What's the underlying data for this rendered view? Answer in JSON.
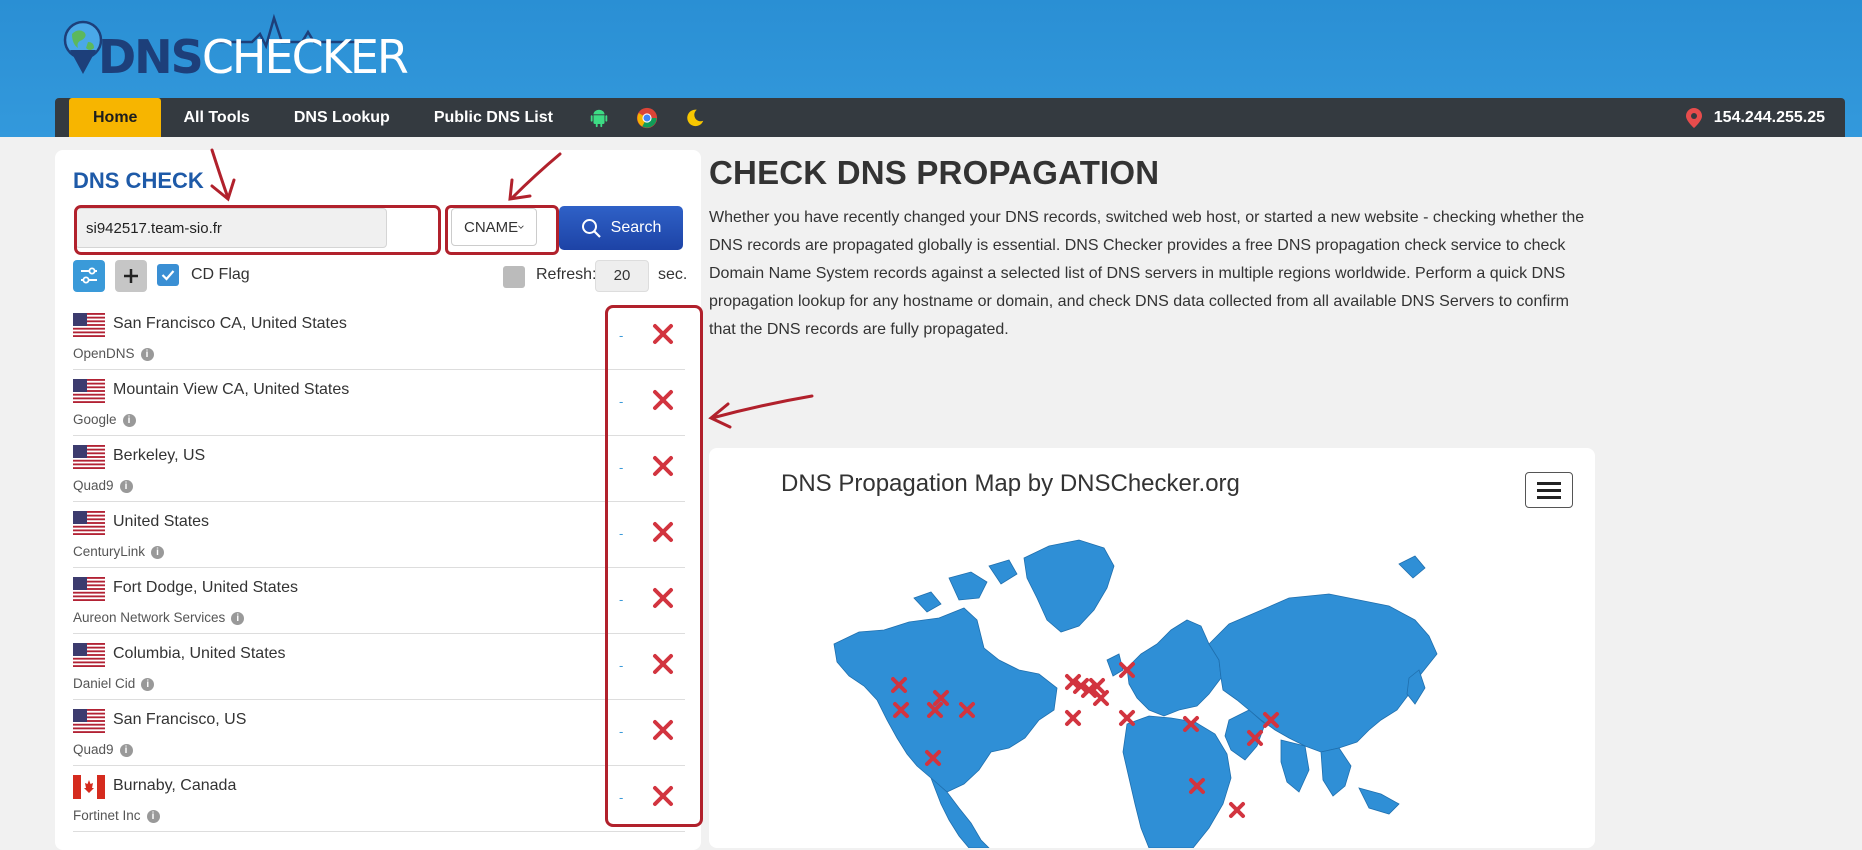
{
  "header": {
    "logo_dns": "DNS",
    "logo_checker": "CHECKER"
  },
  "nav": {
    "items": [
      "Home",
      "All Tools",
      "DNS Lookup",
      "Public DNS List"
    ],
    "icons": [
      "android-icon",
      "chrome-icon",
      "moon-icon"
    ],
    "ip": "154.244.255.25"
  },
  "dns_check": {
    "title": "DNS CHECK",
    "domain_value": "si942517.team-sio.fr",
    "record_type": "CNAME",
    "search_label": "Search",
    "cd_flag_label": "CD Flag",
    "refresh_label": "Refresh:",
    "refresh_value": "20",
    "refresh_unit": "sec."
  },
  "servers": [
    {
      "location": "San Francisco CA, United States",
      "provider": "OpenDNS",
      "flag": "us",
      "result": "-"
    },
    {
      "location": "Mountain View CA, United States",
      "provider": "Google",
      "flag": "us",
      "result": "-"
    },
    {
      "location": "Berkeley, US",
      "provider": "Quad9",
      "flag": "us",
      "result": "-"
    },
    {
      "location": "United States",
      "provider": "CenturyLink",
      "flag": "us",
      "result": "-"
    },
    {
      "location": "Fort Dodge, United States",
      "provider": "Aureon Network Services",
      "flag": "us",
      "result": "-"
    },
    {
      "location": "Columbia, United States",
      "provider": "Daniel Cid",
      "flag": "us",
      "result": "-"
    },
    {
      "location": "San Francisco, US",
      "provider": "Quad9",
      "flag": "us",
      "result": "-"
    },
    {
      "location": "Burnaby, Canada",
      "provider": "Fortinet Inc",
      "flag": "ca",
      "result": "-"
    }
  ],
  "content": {
    "title": "CHECK DNS PROPAGATION",
    "description": "Whether you have recently changed your DNS records, switched web host, or started a new website - checking whether the DNS records are propagated globally is essential. DNS Checker provides a free DNS propagation check service to check Domain Name System records against a selected list of DNS servers in multiple regions worldwide. Perform a quick DNS propagation lookup for any hostname or domain, and check DNS data collected from all available DNS Servers to confirm that the DNS records are fully propagated."
  },
  "map": {
    "title": "DNS Propagation Map by DNSChecker.org"
  },
  "colors": {
    "header_blue": "#3399dc",
    "nav_dark": "#343a40",
    "accent_yellow": "#f7b500",
    "title_blue": "#1e5aa8",
    "fail_red": "#d2343f",
    "annotation_red": "#b1212c"
  }
}
